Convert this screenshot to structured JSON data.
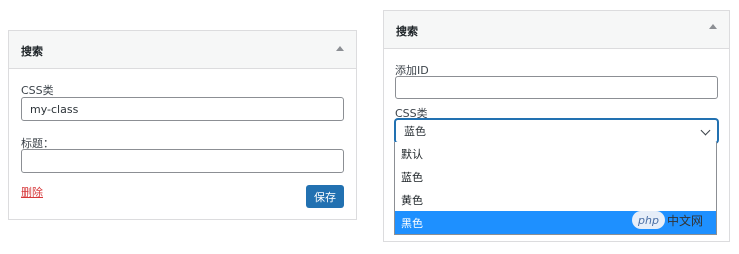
{
  "left_widget": {
    "title": "搜索",
    "css_class_label": "CSS类",
    "css_class_value": "my-class",
    "title_label": "标题：",
    "title_value": "",
    "delete_label": "删除",
    "save_label": "保存"
  },
  "right_widget": {
    "title": "搜索",
    "add_id_label": "添加ID",
    "add_id_value": "",
    "css_class_label": "CSS类",
    "css_class_selected": "蓝色",
    "options": [
      {
        "label": "默认",
        "selected": false
      },
      {
        "label": "蓝色",
        "selected": false
      },
      {
        "label": "黄色",
        "selected": false
      },
      {
        "label": "黑色",
        "selected": true
      }
    ]
  },
  "watermark": {
    "logo_text": "php",
    "site_text": "中文网"
  },
  "colors": {
    "accent": "#2271b1",
    "highlight": "#1e90ff",
    "danger": "#d63638"
  },
  "icons": {
    "collapse": "caret-up-icon",
    "dropdown": "chevron-down-icon"
  }
}
